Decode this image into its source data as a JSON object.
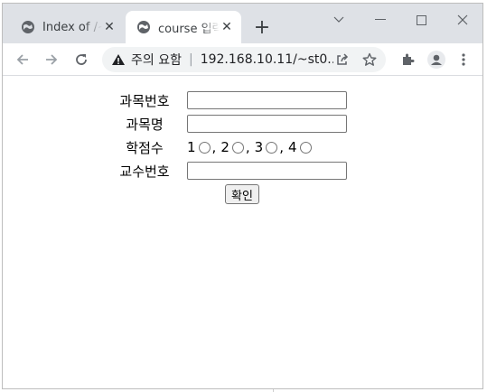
{
  "tabs": [
    {
      "title": "Index of /~",
      "icon": "globe-icon",
      "active": false
    },
    {
      "title": "course 입력",
      "icon": "globe-icon",
      "active": true
    }
  ],
  "omnibox": {
    "security_label": "주의 요함",
    "url": "192.168.10.11/~st0..."
  },
  "form": {
    "course_no_label": "과목번호",
    "course_name_label": "과목명",
    "credits_label": "학점수",
    "credit_options": [
      "1",
      "2",
      "3",
      "4"
    ],
    "professor_no_label": "교수번호",
    "course_no_value": "",
    "course_name_value": "",
    "professor_no_value": "",
    "submit_label": "확인"
  }
}
